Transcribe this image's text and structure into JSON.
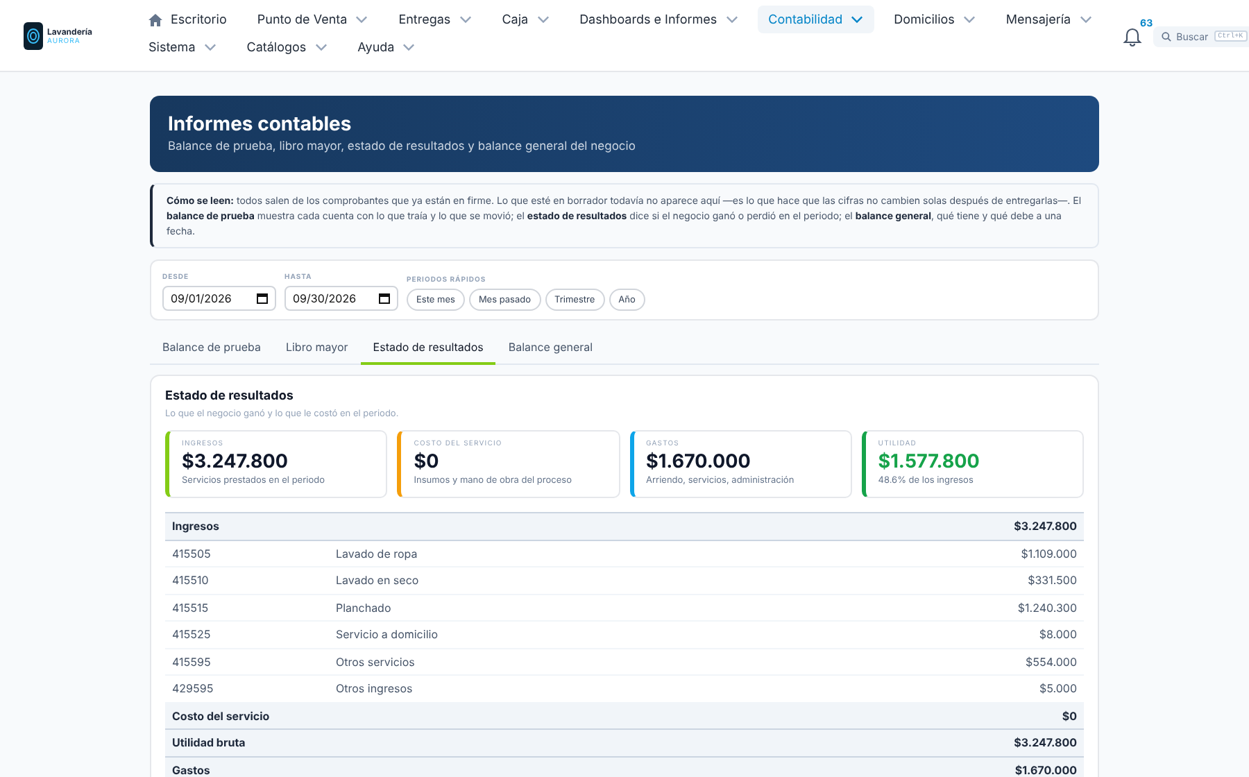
{
  "brand": {
    "name": "Lavandería",
    "subtitle": "AURORA"
  },
  "nav_rows": [
    [
      {
        "label": "Escritorio",
        "kind": "home",
        "dropdown": false,
        "selected": false
      },
      {
        "label": "Punto de Venta",
        "kind": "menu",
        "dropdown": true,
        "selected": false
      },
      {
        "label": "Entregas",
        "kind": "menu",
        "dropdown": true,
        "selected": false
      },
      {
        "label": "Caja",
        "kind": "menu",
        "dropdown": true,
        "selected": false
      },
      {
        "label": "Dashboards e Informes",
        "kind": "menu",
        "dropdown": true,
        "selected": false
      },
      {
        "label": "Contabilidad",
        "kind": "menu",
        "dropdown": true,
        "selected": true
      },
      {
        "label": "Domicilios",
        "kind": "menu",
        "dropdown": true,
        "selected": false
      },
      {
        "label": "Mensajería",
        "kind": "menu",
        "dropdown": true,
        "selected": false
      }
    ],
    [
      {
        "label": "Sistema",
        "kind": "menu",
        "dropdown": true,
        "selected": false
      },
      {
        "label": "Catálogos",
        "kind": "menu",
        "dropdown": true,
        "selected": false
      },
      {
        "label": "Ayuda",
        "kind": "menu",
        "dropdown": true,
        "selected": false
      }
    ]
  ],
  "notifications": {
    "count": "63"
  },
  "search": {
    "placeholder": "Buscar",
    "shortcut": "Ctrl+K"
  },
  "hero": {
    "title": "Informes contables",
    "subtitle": "Balance de prueba, libro mayor, estado de resultados y balance general del negocio"
  },
  "info": "**Cómo se leen:** todos salen de los comprobantes que ya están en firme. Lo que esté en borrador todavía no aparece aquí —es lo que hace que las cifras no cambien solas después de entregarlas—. El **balance de prueba** muestra cada cuenta con lo que traía y lo que se movió; el **estado de resultados** dice si el negocio ganó o perdió en el periodo; el **balance general**, qué tiene y qué debe a una fecha.",
  "filters": {
    "from": {
      "label": "DESDE",
      "value": "09/01/2026"
    },
    "to": {
      "label": "HASTA",
      "value": "09/30/2026"
    },
    "quick_label": "PERIODOS RÁPIDOS",
    "quick": [
      "Este mes",
      "Mes pasado",
      "Trimestre",
      "Año"
    ]
  },
  "tabs": [
    {
      "label": "Balance de prueba",
      "selected": false
    },
    {
      "label": "Libro mayor",
      "selected": false
    },
    {
      "label": "Estado de resultados",
      "selected": true
    },
    {
      "label": "Balance general",
      "selected": false
    }
  ],
  "report": {
    "title": "Estado de resultados",
    "subtitle": "Lo que el negocio ganó y lo que le costó en el periodo.",
    "cards": [
      {
        "label": "INGRESOS",
        "value": "$3.247.800",
        "note": "Servicios prestados en el periodo",
        "color": "#84cc16",
        "positive": false
      },
      {
        "label": "COSTO DEL SERVICIO",
        "value": "$0",
        "note": "Insumos y mano de obra del proceso",
        "color": "#f59e0b",
        "positive": false
      },
      {
        "label": "GASTOS",
        "value": "$1.670.000",
        "note": "Arriendo, servicios, administración",
        "color": "#0ea5e9",
        "positive": false
      },
      {
        "label": "UTILIDAD",
        "value": "$1.577.800",
        "note": "48.6% de los ingresos",
        "color": "#16a34a",
        "positive": true
      }
    ],
    "rows": [
      {
        "kind": "section",
        "label": "Ingresos",
        "amount": "$3.247.800"
      },
      {
        "kind": "account",
        "code": "415505",
        "label": "Lavado de ropa",
        "amount": "$1.109.000"
      },
      {
        "kind": "account",
        "code": "415510",
        "label": "Lavado en seco",
        "amount": "$331.500"
      },
      {
        "kind": "account",
        "code": "415515",
        "label": "Planchado",
        "amount": "$1.240.300"
      },
      {
        "kind": "account",
        "code": "415525",
        "label": "Servicio a domicilio",
        "amount": "$8.000"
      },
      {
        "kind": "account",
        "code": "415595",
        "label": "Otros servicios",
        "amount": "$554.000"
      },
      {
        "kind": "account",
        "code": "429595",
        "label": "Otros ingresos",
        "amount": "$5.000"
      },
      {
        "kind": "section",
        "label": "Costo del servicio",
        "amount": "$0"
      },
      {
        "kind": "section",
        "label": "Utilidad bruta",
        "amount": "$3.247.800"
      },
      {
        "kind": "section",
        "label": "Gastos",
        "amount": "$1.670.000"
      }
    ]
  }
}
